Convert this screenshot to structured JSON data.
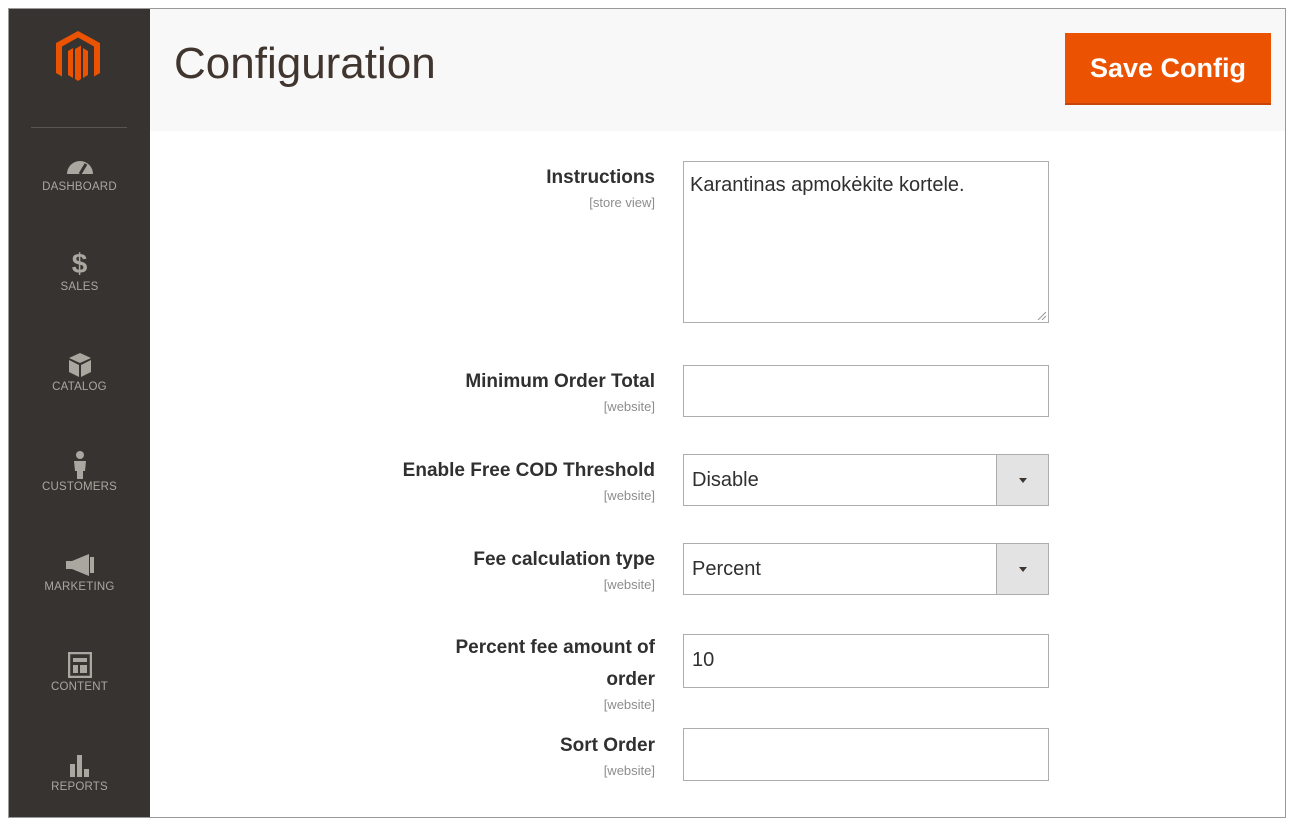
{
  "header": {
    "title": "Configuration",
    "save_label": "Save Config"
  },
  "sidebar": {
    "items": [
      {
        "label": "DASHBOARD",
        "icon": "dashboard-icon"
      },
      {
        "label": "SALES",
        "icon": "dollar-icon"
      },
      {
        "label": "CATALOG",
        "icon": "box-icon"
      },
      {
        "label": "CUSTOMERS",
        "icon": "person-icon"
      },
      {
        "label": "MARKETING",
        "icon": "megaphone-icon"
      },
      {
        "label": "CONTENT",
        "icon": "layout-icon"
      },
      {
        "label": "REPORTS",
        "icon": "bar-chart-icon"
      }
    ]
  },
  "form": {
    "instructions": {
      "label": "Instructions",
      "scope": "[store view]",
      "value": "Karantinas apmokėkite kortele."
    },
    "min_order_total": {
      "label": "Minimum Order Total",
      "scope": "[website]",
      "value": ""
    },
    "free_cod_threshold": {
      "label": "Enable Free COD Threshold",
      "scope": "[website]",
      "value": "Disable"
    },
    "fee_calc_type": {
      "label": "Fee calculation type",
      "scope": "[website]",
      "value": "Percent"
    },
    "percent_fee": {
      "label_line1": "Percent fee amount of",
      "label_line2": "order",
      "scope": "[website]",
      "value": "10"
    },
    "sort_order": {
      "label": "Sort Order",
      "scope": "[website]",
      "value": ""
    }
  },
  "colors": {
    "accent": "#eb5202",
    "sidebar": "#373330",
    "header_bg": "#f8f8f8"
  }
}
